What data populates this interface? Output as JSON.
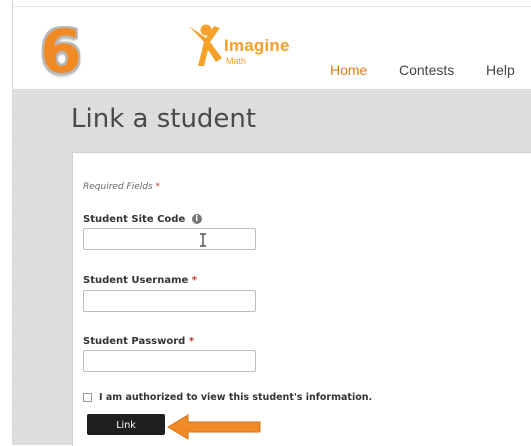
{
  "overlay": {
    "step_number": "6"
  },
  "header": {
    "logo": {
      "word": "Imagine",
      "sub": "Math",
      "icon": "imagine-person-icon",
      "color": "#f5a12a"
    },
    "nav": [
      {
        "label": "Home",
        "active": true
      },
      {
        "label": "Contests",
        "active": false
      },
      {
        "label": "Help",
        "active": false
      }
    ],
    "accent_color": "#e07b1c"
  },
  "page": {
    "title": "Link a student"
  },
  "form": {
    "required_note": "Required Fields",
    "required_marker": "*",
    "fields": {
      "site_code": {
        "label": "Student Site Code",
        "value": "",
        "icon": "info-icon"
      },
      "username": {
        "label": "Student Username",
        "value": ""
      },
      "password": {
        "label": "Student Password",
        "value": ""
      }
    },
    "authorize": {
      "label": "I am authorized to view this student's information.",
      "checked": false
    },
    "submit_label": "Link"
  },
  "annotation": {
    "arrow_icon": "orange-arrow-icon",
    "color": "#f08a24"
  }
}
